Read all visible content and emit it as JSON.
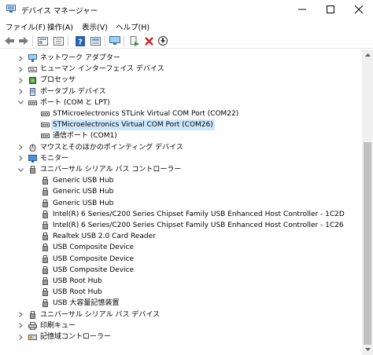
{
  "window": {
    "title": "デバイス マネージャー",
    "icon": "device-manager-icon",
    "controls": [
      "minimize-icon",
      "maximize-icon",
      "close-icon"
    ]
  },
  "menu": {
    "items": [
      "ファイル(F)",
      "操作(A)",
      "表示(V)",
      "ヘルプ(H)"
    ]
  },
  "toolbar": {
    "buttons": [
      "back-icon",
      "forward-icon",
      "properties-icon",
      "show-hidden-icon",
      "help-icon",
      "update-icon",
      "monitor-icon",
      "enable-device-icon",
      "uninstall-icon",
      "download-icon"
    ]
  },
  "tree": {
    "rows": [
      {
        "label": "ネットワーク アダプター",
        "expander": "collapsed",
        "icon": "network-icon",
        "level": 0
      },
      {
        "label": "ヒューマン インターフェイス デバイス",
        "expander": "collapsed",
        "icon": "hid-icon",
        "level": 0
      },
      {
        "label": "プロセッサ",
        "expander": "collapsed",
        "icon": "processor-icon",
        "level": 0
      },
      {
        "label": "ポータブル デバイス",
        "expander": "collapsed",
        "icon": "portable-icon",
        "level": 0
      },
      {
        "label": "ポート (COM と LPT)",
        "expander": "expanded",
        "icon": "port-icon",
        "level": 0
      },
      {
        "label": "STMicroelectronics STLink Virtual COM Port (COM22)",
        "expander": "none",
        "icon": "port-icon",
        "level": 1
      },
      {
        "label": "STMicroelectronics Virtual COM Port (COM26)",
        "expander": "none",
        "icon": "port-icon",
        "level": 1,
        "selected": true
      },
      {
        "label": "通信ポート (COM1)",
        "expander": "none",
        "icon": "port-icon",
        "level": 1
      },
      {
        "label": "マウスとそのほかのポインティング デバイス",
        "expander": "collapsed",
        "icon": "mouse-icon",
        "level": 0
      },
      {
        "label": "モニター",
        "expander": "collapsed",
        "icon": "monitor-icon",
        "level": 0
      },
      {
        "label": "ユニバーサル シリアル バス コントローラー",
        "expander": "expanded",
        "icon": "usb-icon",
        "level": 0
      },
      {
        "label": "Generic USB Hub",
        "expander": "none",
        "icon": "usb-icon",
        "level": 1
      },
      {
        "label": "Generic USB Hub",
        "expander": "none",
        "icon": "usb-icon",
        "level": 1
      },
      {
        "label": "Generic USB Hub",
        "expander": "none",
        "icon": "usb-icon",
        "level": 1
      },
      {
        "label": "Intel(R) 6 Series/C200 Series Chipset Family USB Enhanced Host Controller - 1C2D",
        "expander": "none",
        "icon": "usb-icon",
        "level": 1
      },
      {
        "label": "Intel(R) 6 Series/C200 Series Chipset Family USB Enhanced Host Controller - 1C26",
        "expander": "none",
        "icon": "usb-icon",
        "level": 1
      },
      {
        "label": "Realtek USB 2.0 Card Reader",
        "expander": "none",
        "icon": "usb-icon",
        "level": 1
      },
      {
        "label": "USB Composite Device",
        "expander": "none",
        "icon": "usb-icon",
        "level": 1
      },
      {
        "label": "USB Composite Device",
        "expander": "none",
        "icon": "usb-icon",
        "level": 1
      },
      {
        "label": "USB Composite Device",
        "expander": "none",
        "icon": "usb-icon",
        "level": 1
      },
      {
        "label": "USB Root Hub",
        "expander": "none",
        "icon": "usb-icon",
        "level": 1
      },
      {
        "label": "USB Root Hub",
        "expander": "none",
        "icon": "usb-icon",
        "level": 1
      },
      {
        "label": "USB 大容量記憶装置",
        "expander": "none",
        "icon": "usb-icon",
        "level": 1
      },
      {
        "label": "ユニバーサル シリアル バス デバイス",
        "expander": "collapsed",
        "icon": "usb-icon",
        "level": 0
      },
      {
        "label": "印刷キュー",
        "expander": "collapsed",
        "icon": "printer-icon",
        "level": 0
      },
      {
        "label": "記憶域コントローラー",
        "expander": "collapsed",
        "icon": "storage-icon",
        "level": 0
      }
    ]
  },
  "colors": {
    "selection": "#cce8ff",
    "scrollbar_thumb": "#c1c1c1"
  },
  "scrollbar": {
    "position_fraction": 0.31
  }
}
